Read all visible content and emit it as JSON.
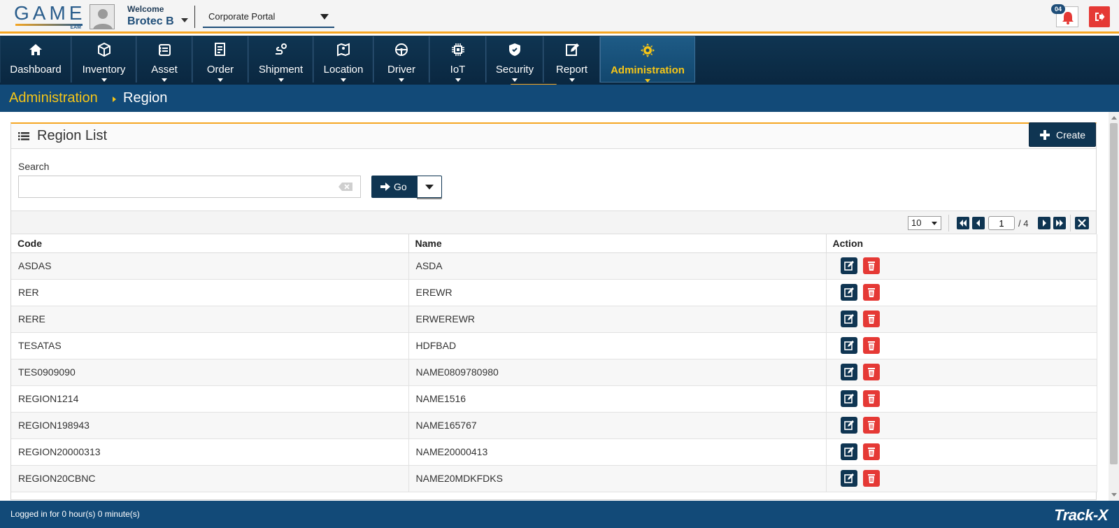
{
  "header": {
    "logo_text": "GAME",
    "logo_sub": "EAM",
    "welcome_label": "Welcome",
    "user_name": "Brotec B",
    "portal_selected": "Corporate Portal",
    "notification_count": "04"
  },
  "nav": {
    "items": [
      {
        "label": "Dashboard",
        "icon": "home-icon"
      },
      {
        "label": "Inventory",
        "icon": "box-icon"
      },
      {
        "label": "Asset",
        "icon": "asset-icon"
      },
      {
        "label": "Order",
        "icon": "order-icon"
      },
      {
        "label": "Shipment",
        "icon": "shipment-icon"
      },
      {
        "label": "Location",
        "icon": "map-icon"
      },
      {
        "label": "Driver",
        "icon": "steering-wheel-icon"
      },
      {
        "label": "IoT",
        "icon": "chip-icon"
      },
      {
        "label": "Security",
        "icon": "shield-icon"
      },
      {
        "label": "Report",
        "icon": "edit-report-icon"
      },
      {
        "label": "Administration",
        "icon": "gear-icon"
      }
    ],
    "active": "Administration"
  },
  "breadcrumb": {
    "parent": "Administration",
    "current": "Region"
  },
  "panel": {
    "title": "Region List",
    "create_label": "Create",
    "search_label": "Search",
    "search_value": "",
    "go_label": "Go"
  },
  "pager": {
    "page_size": "10",
    "current_page": "1",
    "total_pages": "/ 4"
  },
  "table": {
    "columns": [
      "Code",
      "Name",
      "Action"
    ],
    "rows": [
      {
        "code": "ASDAS",
        "name": "ASDA"
      },
      {
        "code": "RER",
        "name": "EREWR"
      },
      {
        "code": "RERE",
        "name": "ERWEREWR"
      },
      {
        "code": "TESATAS",
        "name": "HDFBAD"
      },
      {
        "code": "TES0909090",
        "name": "NAME0809780980"
      },
      {
        "code": "REGION1214",
        "name": "NAME1516"
      },
      {
        "code": "REGION198943",
        "name": "NAME165767"
      },
      {
        "code": "REGION20000313",
        "name": "NAME20000413"
      },
      {
        "code": "REGION20CBNC",
        "name": "NAME20MDKFDKS"
      }
    ]
  },
  "footer": {
    "session_text": "Logged in for 0 hour(s) 0 minute(s)",
    "brand": "Track-X"
  },
  "colors": {
    "navy": "#0f3552",
    "accent_orange": "#f5a623",
    "accent_yellow": "#f5c518",
    "delete_red": "#e53935",
    "bar_blue": "#124a78"
  }
}
